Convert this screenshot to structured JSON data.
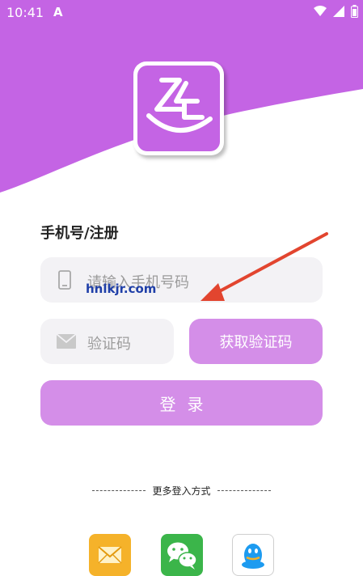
{
  "status_bar": {
    "time": "10:41",
    "app_indicator": "A",
    "icons": [
      "wifi-icon",
      "signal-icon",
      "battery-icon"
    ]
  },
  "form": {
    "title": "手机号/注册",
    "phone_placeholder": "请输入手机号码",
    "code_placeholder": "验证码",
    "get_code_label": "获取验证码",
    "login_label": "登录"
  },
  "watermark": "hnlkjr.com",
  "alt_login": {
    "label": "更多登入方式",
    "methods": [
      "mail-icon",
      "wechat-icon",
      "qq-icon"
    ]
  },
  "colors": {
    "brand_purple": "#c464e4",
    "button_purple": "#d48ee8",
    "field_bg": "#f3f2f5",
    "arrow_red": "#e2452f"
  }
}
